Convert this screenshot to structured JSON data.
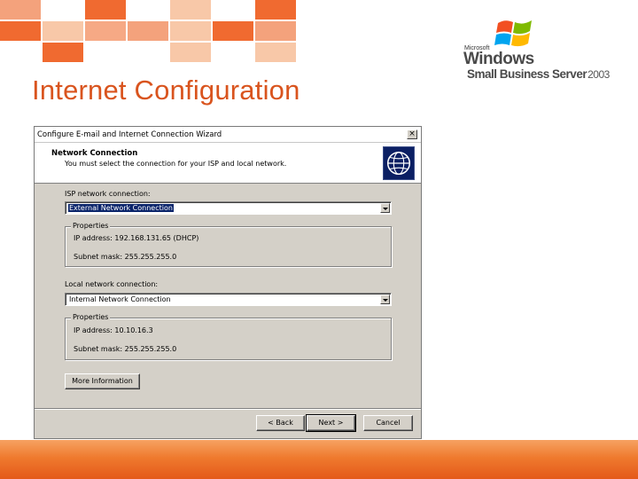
{
  "slide": {
    "title": "Internet Configuration"
  },
  "logo": {
    "microsoft": "Microsoft",
    "windows": "Windows",
    "product": "Small Business Server",
    "year": "2003"
  },
  "dialog": {
    "title": "Configure E-mail and Internet Connection Wizard",
    "close_label": "×",
    "header_title": "Network Connection",
    "header_subtitle": "You must select the connection for your ISP and local network.",
    "isp": {
      "label": "ISP network connection:",
      "selected": "External Network Connection",
      "properties_title": "Properties",
      "ip": "IP address: 192.168.131.65 (DHCP)",
      "subnet": "Subnet mask: 255.255.255.0"
    },
    "local": {
      "label": "Local network connection:",
      "selected": "Internal Network Connection",
      "properties_title": "Properties",
      "ip": "IP address: 10.10.16.3",
      "subnet": "Subnet mask: 255.255.255.0"
    },
    "buttons": {
      "more_info": "More Information",
      "back": "< Back",
      "next": "Next >",
      "cancel": "Cancel"
    }
  },
  "colors": {
    "title_orange": "#d9541e",
    "tile_orange": "#f06a30",
    "tile_light": "#f8c8a8",
    "selection_blue": "#0a246a",
    "dialog_gray": "#d4d0c8"
  }
}
